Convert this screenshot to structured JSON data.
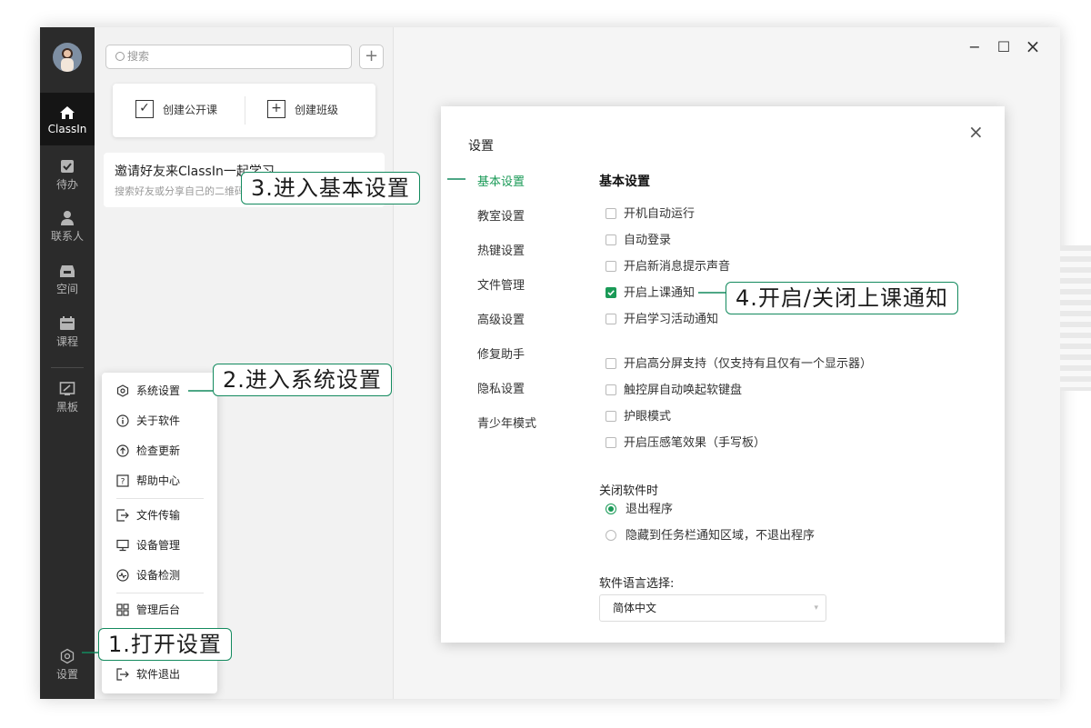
{
  "window_controls": {
    "minimize": "−",
    "maximize": "☐",
    "close": "×"
  },
  "rail": {
    "items": [
      {
        "label": "ClassIn",
        "icon": "home-icon"
      },
      {
        "label": "待办",
        "icon": "todo-icon"
      },
      {
        "label": "联系人",
        "icon": "contacts-icon"
      },
      {
        "label": "空间",
        "icon": "inbox-icon"
      },
      {
        "label": "课程",
        "icon": "calendar-icon"
      },
      {
        "label": "黑板",
        "icon": "blackboard-icon"
      }
    ],
    "settings_label": "设置"
  },
  "sidepanel": {
    "search_placeholder": "搜索",
    "add_label": "+",
    "create_open_class": "创建公开课",
    "create_class": "创建班级",
    "invite_title": "邀请好友来ClassIn一起学习",
    "invite_sub": "搜索好友或分享自己的二维码"
  },
  "menu": {
    "items": [
      {
        "label": "系统设置",
        "icon": "gear-icon"
      },
      {
        "label": "关于软件",
        "icon": "info-icon"
      },
      {
        "label": "检查更新",
        "icon": "update-icon"
      },
      {
        "label": "帮助中心",
        "icon": "help-icon"
      },
      {
        "label": "文件传输",
        "icon": "file-transfer-icon"
      },
      {
        "label": "设备管理",
        "icon": "monitor-icon"
      },
      {
        "label": "设备检测",
        "icon": "device-check-icon"
      },
      {
        "label": "管理后台",
        "icon": "grid-icon"
      },
      {
        "label": "软件退出",
        "icon": "exit-icon"
      }
    ]
  },
  "settings": {
    "title": "设置",
    "close": "×",
    "nav": [
      "基本设置",
      "教室设置",
      "热键设置",
      "文件管理",
      "高级设置",
      "修复助手",
      "隐私设置",
      "青少年模式"
    ],
    "section_title": "基本设置",
    "options_group1": [
      {
        "label": "开机自动运行",
        "checked": false
      },
      {
        "label": "自动登录",
        "checked": false
      },
      {
        "label": "开启新消息提示声音",
        "checked": false
      },
      {
        "label": "开启上课通知",
        "checked": true
      },
      {
        "label": "开启学习活动通知",
        "checked": false
      }
    ],
    "options_group2": [
      {
        "label": "开启高分屏支持（仅支持有且仅有一个显示器）",
        "checked": false
      },
      {
        "label": "触控屏自动唤起软键盘",
        "checked": false
      },
      {
        "label": "护眼模式",
        "checked": false
      },
      {
        "label": "开启压感笔效果（手写板）",
        "checked": false
      }
    ],
    "close_heading": "关闭软件时",
    "close_options": [
      {
        "label": "退出程序",
        "selected": true
      },
      {
        "label": "隐藏到任务栏通知区域，不退出程序",
        "selected": false
      }
    ],
    "language_heading": "软件语言选择:",
    "language_value": "简体中文"
  },
  "callouts": {
    "step1": "1.打开设置",
    "step2": "2.进入系统设置",
    "step3": "3.进入基本设置",
    "step4": "4.开启/关闭上课通知"
  },
  "colors": {
    "accent": "#1a9a57",
    "rail_bg": "#2b2b2b",
    "callout_border": "#138a5e"
  }
}
